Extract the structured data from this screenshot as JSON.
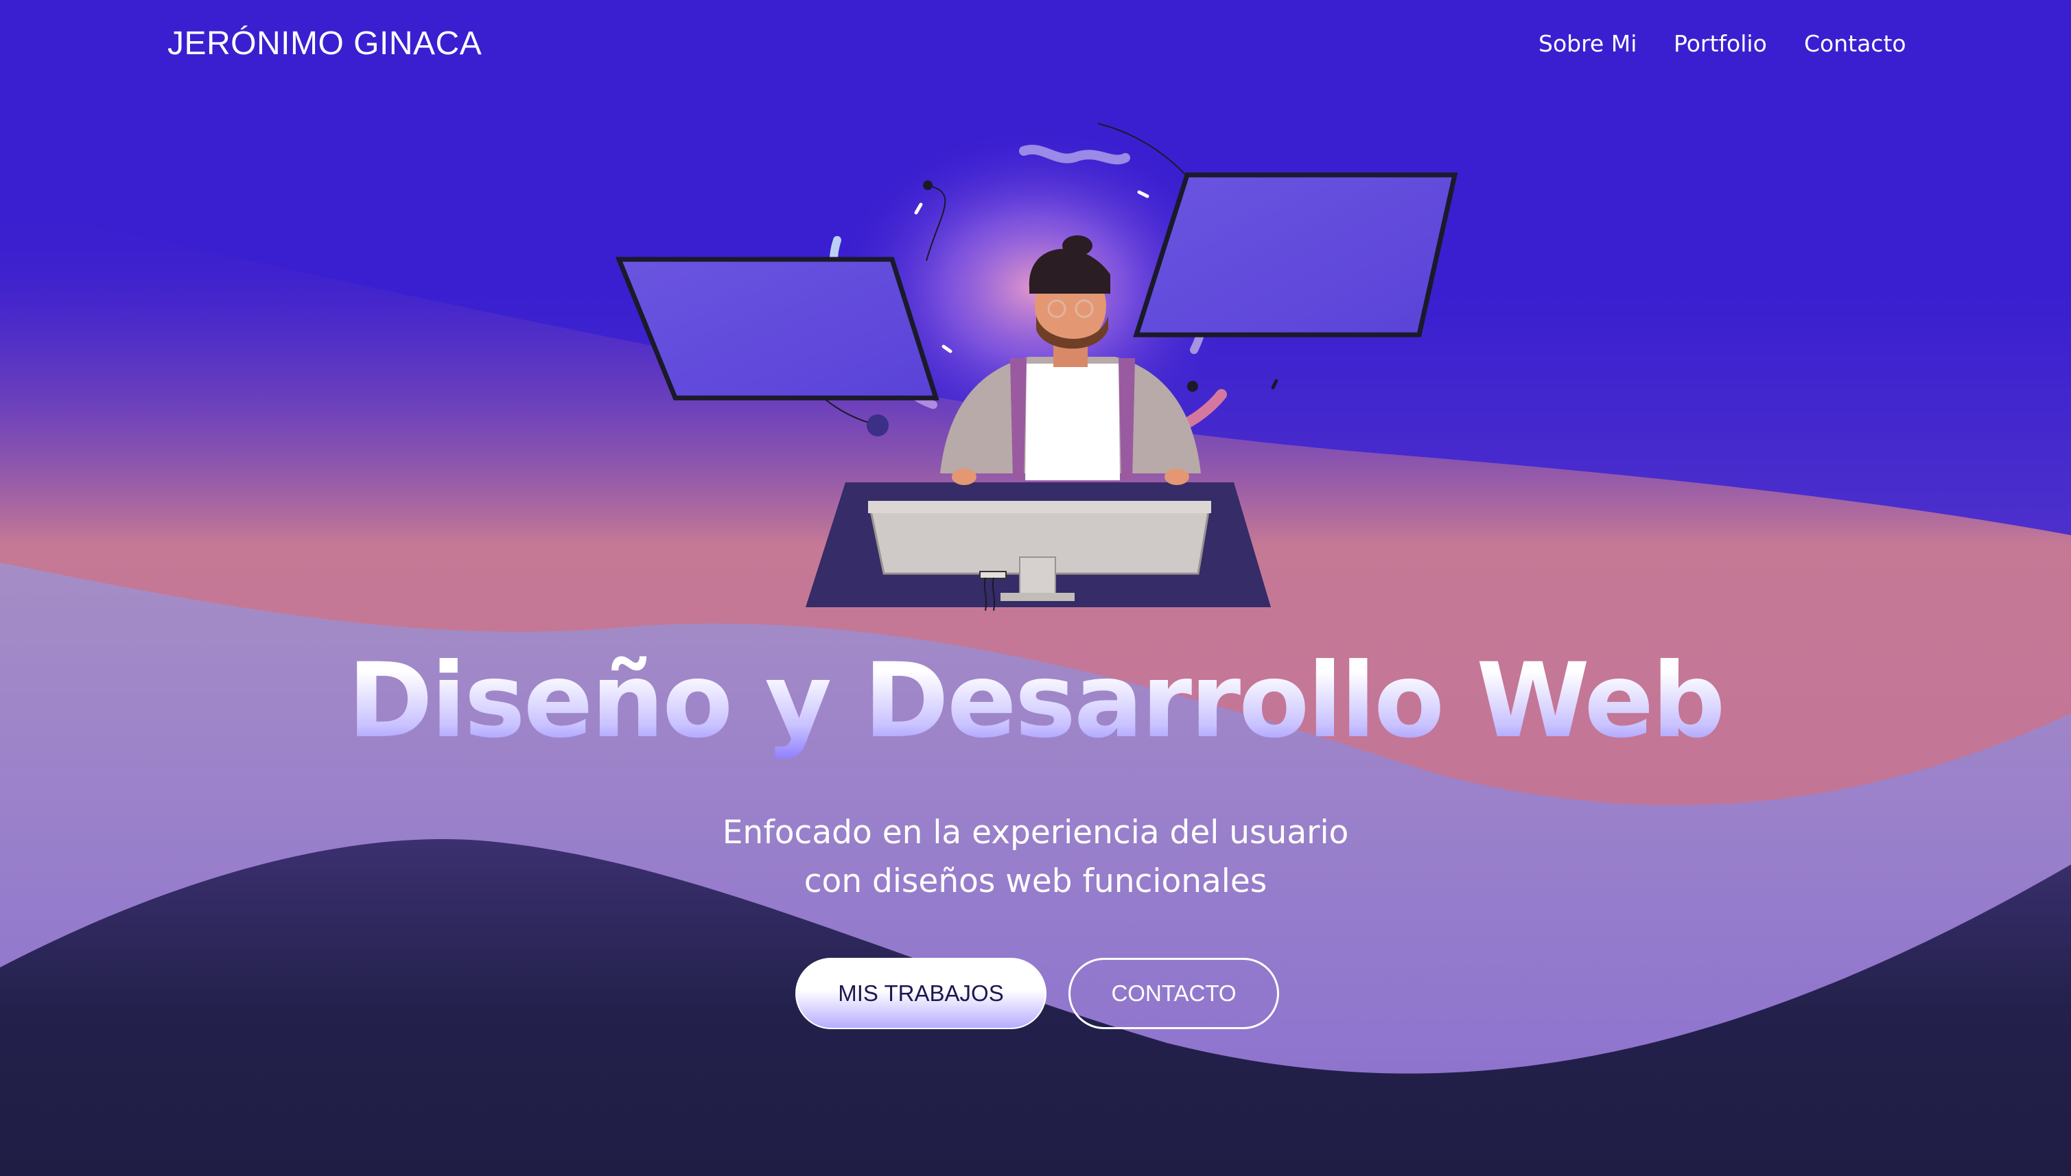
{
  "header": {
    "brand": "JERÓNIMO GINACA",
    "nav": [
      {
        "label": "Sobre Mi"
      },
      {
        "label": "Portfolio"
      },
      {
        "label": "Contacto"
      }
    ]
  },
  "hero": {
    "title": "Diseño y Desarrollo Web",
    "subtitle_lines": [
      "Enfocado en la experiencia del usuario",
      "con diseños web funcionales"
    ],
    "buttons": {
      "primary": "MIS TRABAJOS",
      "secondary": "CONTACTO"
    }
  },
  "colors": {
    "background_top": "#3a1fd0",
    "wave_pink": "#c47a9a",
    "wave_lilac": "#9a84cf",
    "wave_dark": "#1f1d44",
    "button_text_dark": "#1c1850"
  }
}
